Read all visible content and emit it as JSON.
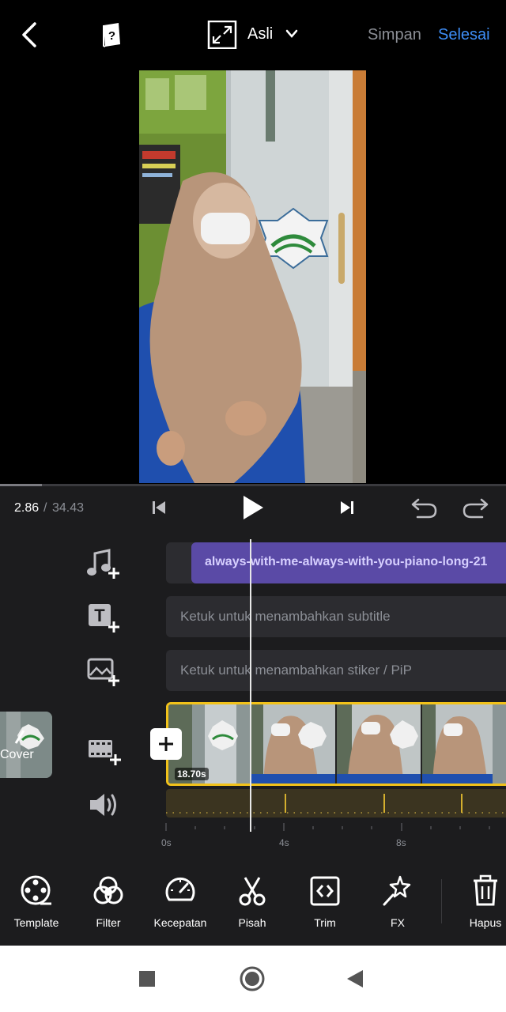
{
  "topbar": {
    "back_icon": "chevron-left-icon",
    "help_icon": "help-book-icon",
    "ratio_icon": "expand-arrows-icon",
    "ratio_label": "Asli",
    "save_label": "Simpan",
    "done_label": "Selesai",
    "done_color": "#3e8ef7"
  },
  "player": {
    "current_time": "2.86",
    "separator": "/",
    "total_time": "34.43",
    "progress": 0.083
  },
  "tracks": {
    "music_label": "always-with-me-always-with-you-piano-long-21",
    "subtitle_placeholder": "Ketuk untuk menambahkan subtitle",
    "sticker_placeholder": "Ketuk untuk menambahkan stiker / PiP",
    "clip_duration": "18.70s",
    "cover_label": "Cover"
  },
  "ruler": {
    "labels": [
      "0s",
      "4s",
      "8s"
    ]
  },
  "toolbar": {
    "items": [
      {
        "label": "Template",
        "icon": "film-reel-icon"
      },
      {
        "label": "Filter",
        "icon": "filter-circles-icon"
      },
      {
        "label": "Kecepatan",
        "icon": "speedometer-icon"
      },
      {
        "label": "Pisah",
        "icon": "scissors-icon"
      },
      {
        "label": "Trim",
        "icon": "trim-brackets-icon"
      },
      {
        "label": "FX",
        "icon": "magic-star-icon"
      },
      {
        "label": "Hapus",
        "icon": "trash-icon"
      }
    ]
  },
  "colors": {
    "accent_blue": "#3e8ef7",
    "selection_yellow": "#f2c21a",
    "music_purple": "#5a4aa6",
    "panel_bg": "#1c1c1e"
  }
}
